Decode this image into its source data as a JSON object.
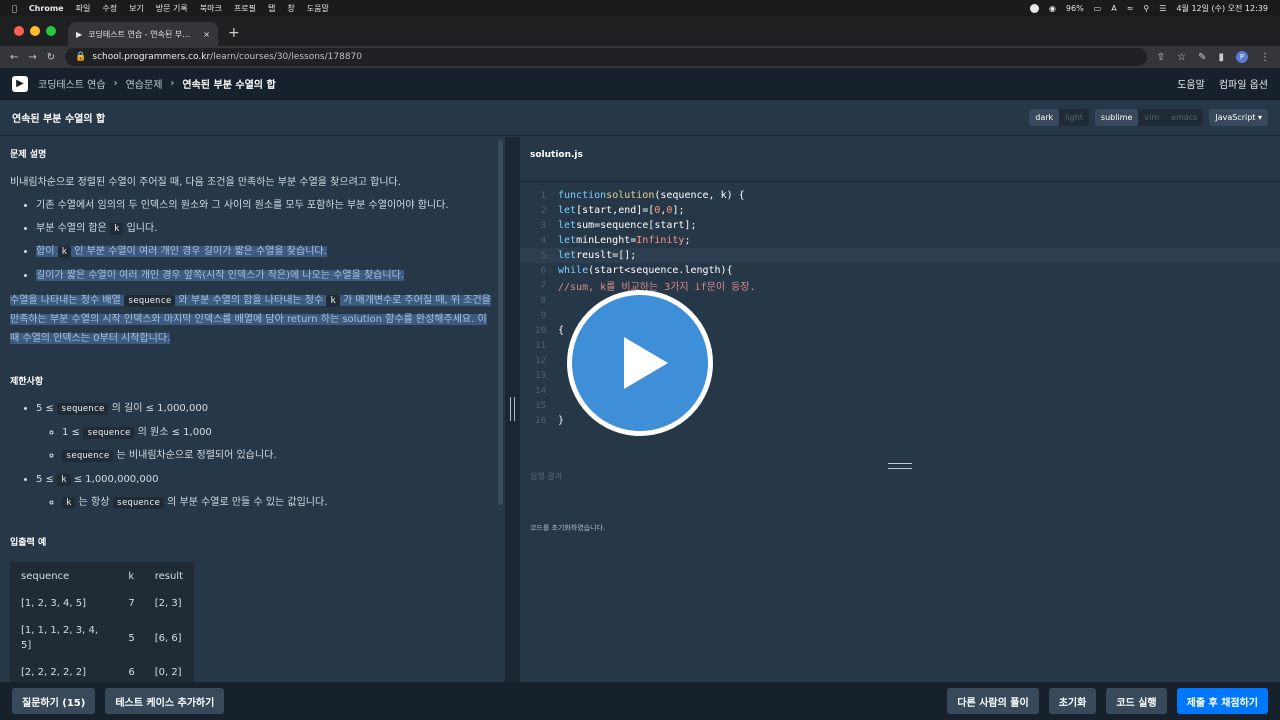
{
  "mac_bar": {
    "app": "Chrome",
    "menus": [
      "파일",
      "수정",
      "보기",
      "방문 기록",
      "북마크",
      "프로필",
      "탭",
      "창",
      "도움말"
    ],
    "battery": "96%",
    "input_source": "A",
    "datetime": "4월 12일 (수) 오전 12:39"
  },
  "browser": {
    "tab_title": "코딩테스트 연습 - 연속된 부분 수열의 합",
    "url_host": "school.programmers.co.kr",
    "url_path": "/learn/courses/30/lessons/178870"
  },
  "header": {
    "breadcrumbs": [
      "코딩테스트 연습",
      "연습문제",
      "연속된 부분 수열의 합"
    ],
    "help": "도움말",
    "compile_options": "컴파일 옵션"
  },
  "title_bar": {
    "title": "연속된 부분 수열의 합",
    "theme_options": [
      "dark",
      "light"
    ],
    "keymap_options": [
      "sublime",
      "vim",
      "emacs"
    ],
    "language": "JavaScript"
  },
  "problem": {
    "desc_heading": "문제 설명",
    "desc_intro": "비내림차순으로 정렬된 수열이 주어질 때, 다음 조건을 만족하는 부분 수열을 찾으려고 합니다.",
    "cond1": "기존 수열에서 임의의 두 인덱스의 원소와 그 사이의 원소를 모두 포함하는 부분 수열이어야 합니다.",
    "cond2_a": "부분 수열의 합은",
    "cond2_code": "k",
    "cond2_b": "입니다.",
    "cond3_a": "합이",
    "cond3_code": "k",
    "cond3_b": "인 부분 수열이 여러 개인 경우 길이가 짧은 수열을 찾습니다.",
    "cond4": "길이가 짧은 수열이 여러 개인 경우 앞쪽(시작 인덱스가 작은)에 나오는 수열을 찾습니다.",
    "para_a": "수열을 나타내는 정수 배열",
    "para_code1": "sequence",
    "para_b": "와 부분 수열의 합을 나타내는 정수",
    "para_code2": "k",
    "para_c": "가 매개변수로 주어질 때, 위 조건을 만족하는 부분 수열의 시작 인덱스와 마지막 인덱스를 배열에 담아 return 하는 solution 함수를 완성해주세요. 이때 수열의 인덱스는 0부터 시작합니다.",
    "limits_heading": "제한사항",
    "lim1_a": "5 ≤",
    "lim1_code": "sequence",
    "lim1_b": "의 길이 ≤ 1,000,000",
    "lim1_1_a": "1 ≤",
    "lim1_1_code": "sequence",
    "lim1_1_b": "의 원소 ≤ 1,000",
    "lim1_2_code": "sequence",
    "lim1_2_b": "는 비내림차순으로 정렬되어 있습니다.",
    "lim2_a": "5 ≤",
    "lim2_code": "k",
    "lim2_b": "≤ 1,000,000,000",
    "lim2_1_code": "k",
    "lim2_1_b": "는 항상",
    "lim2_1_code2": "sequence",
    "lim2_1_c": "의 부분 수열로 만들 수 있는 값입니다.",
    "io_heading": "입출력 예",
    "io_headers": [
      "sequence",
      "k",
      "result"
    ],
    "io_rows": [
      [
        "[1, 2, 3, 4, 5]",
        "7",
        "[2, 3]"
      ],
      [
        "[1, 1, 1, 2, 3, 4, 5]",
        "5",
        "[6, 6]"
      ],
      [
        "[2, 2, 2, 2, 2]",
        "6",
        "[0, 2]"
      ]
    ]
  },
  "editor": {
    "file_name": "solution.js",
    "line_numbers": [
      "1",
      "2",
      "3",
      "4",
      "5",
      "6",
      "7",
      "8",
      "9",
      "10",
      "11",
      "12",
      "13",
      "14",
      "15",
      "16"
    ],
    "l1_kw": "function",
    "l1_fn": "solution",
    "l1_rest": "(sequence, k) {",
    "l2_kw": "let",
    "l2_a": "[start,end]=[",
    "l2_n1": "0",
    "l2_c": ",",
    "l2_n2": "0",
    "l2_d": "];",
    "l3_kw": "let",
    "l3_a": "sum=sequence[start];",
    "l4_kw": "let",
    "l4_a": "minLenght=",
    "l4_n": "Infinity",
    "l4_b": ";",
    "l5_kw": "let",
    "l5_a": "reuslt=[];",
    "l6_kw": "while",
    "l6_a": "(start<sequence.length){",
    "l7_cmt": "//sum, k를 비교하는 3가지 if문이 등장.",
    "l10_a": "{",
    "l16_a": "}"
  },
  "result": {
    "title": "실행 결과",
    "message": "코드를 초기화하였습니다."
  },
  "footer": {
    "ask": "질문하기 (15)",
    "add_test": "테스트 케이스 추가하기",
    "others": "다른 사람의 풀이",
    "reset": "초기화",
    "run": "코드 실행",
    "submit": "제출 후 채점하기"
  }
}
